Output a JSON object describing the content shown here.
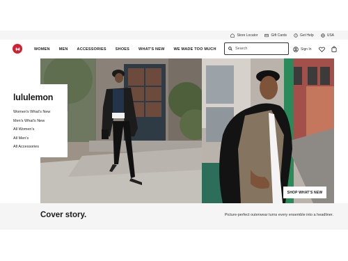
{
  "utility_bar": {
    "items": [
      {
        "label": "Store Locator",
        "icon": "store-locator-icon"
      },
      {
        "label": "Gift Cards",
        "icon": "gift-card-icon"
      },
      {
        "label": "Get Help",
        "icon": "help-icon"
      },
      {
        "label": "USA",
        "icon": "globe-icon"
      }
    ]
  },
  "nav": {
    "logo_icon": "lululemon-logo",
    "links": [
      "WOMEN",
      "MEN",
      "ACCESSORIES",
      "SHOES",
      "WHAT'S NEW",
      "WE MADE TOO MUCH"
    ],
    "search": {
      "placeholder": "Search"
    },
    "sign_in": "Sign In",
    "wishlist_icon": "heart-icon",
    "bag_icon": "shopping-bag-icon",
    "brand_color": "#d22030"
  },
  "hero": {
    "brand_name": "lululemon",
    "menu_links": [
      "Women's What's New",
      "Men's What's New",
      "All Women's",
      "All Men's",
      "All Accessories"
    ],
    "cta": "SHOP WHAT'S NEW"
  },
  "feature": {
    "title": "Cover story.",
    "tagline": "Picture-perfect outerwear turns every ensemble into a headliner."
  }
}
